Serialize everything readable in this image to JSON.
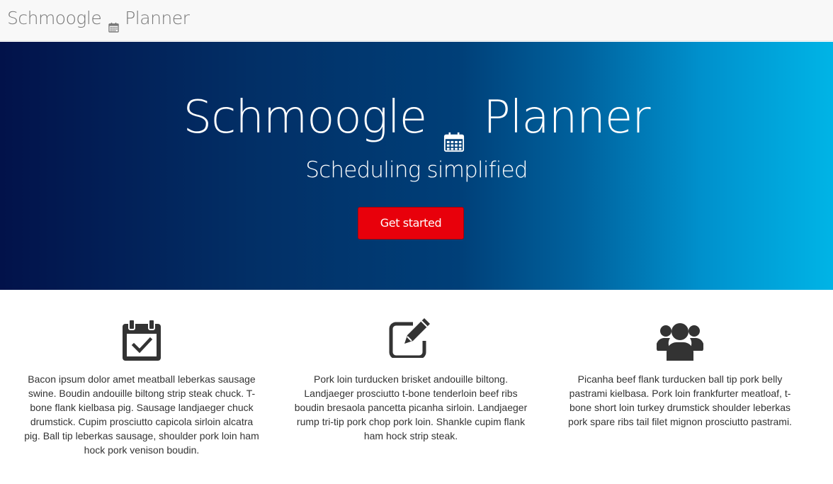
{
  "navbar": {
    "brand_left": "Schmoogle",
    "brand_right": "Planner",
    "brand_icon": "calendar-icon"
  },
  "hero": {
    "title_left": "Schmoogle",
    "title_right": "Planner",
    "title_icon": "calendar-icon",
    "subtitle": "Scheduling simplified",
    "cta_label": "Get started"
  },
  "colors": {
    "hero_gradient_start": "#02124a",
    "hero_gradient_end": "#00b4e6",
    "cta_background": "#e8000b",
    "navbar_background": "#f8f8f8",
    "icon_color": "#333333"
  },
  "features": [
    {
      "icon": "calendar-check-icon",
      "text": "Bacon ipsum dolor amet meatball leberkas sausage swine. Boudin andouille biltong strip steak chuck. T-bone flank kielbasa pig. Sausage landjaeger chuck drumstick. Cupim prosciutto capicola sirloin alcatra pig. Ball tip leberkas sausage, shoulder pork loin ham hock pork venison boudin."
    },
    {
      "icon": "edit-icon",
      "text": "Pork loin turducken brisket andouille biltong. Landjaeger prosciutto t-bone tenderloin beef ribs boudin bresaola pancetta picanha sirloin. Landjaeger rump tri-tip pork chop pork loin. Shankle cupim flank ham hock strip steak."
    },
    {
      "icon": "users-icon",
      "text": "Picanha beef flank turducken ball tip pork belly pastrami kielbasa. Pork loin frankfurter meatloaf, t-bone short loin turkey drumstick shoulder leberkas pork spare ribs tail filet mignon prosciutto pastrami."
    }
  ]
}
